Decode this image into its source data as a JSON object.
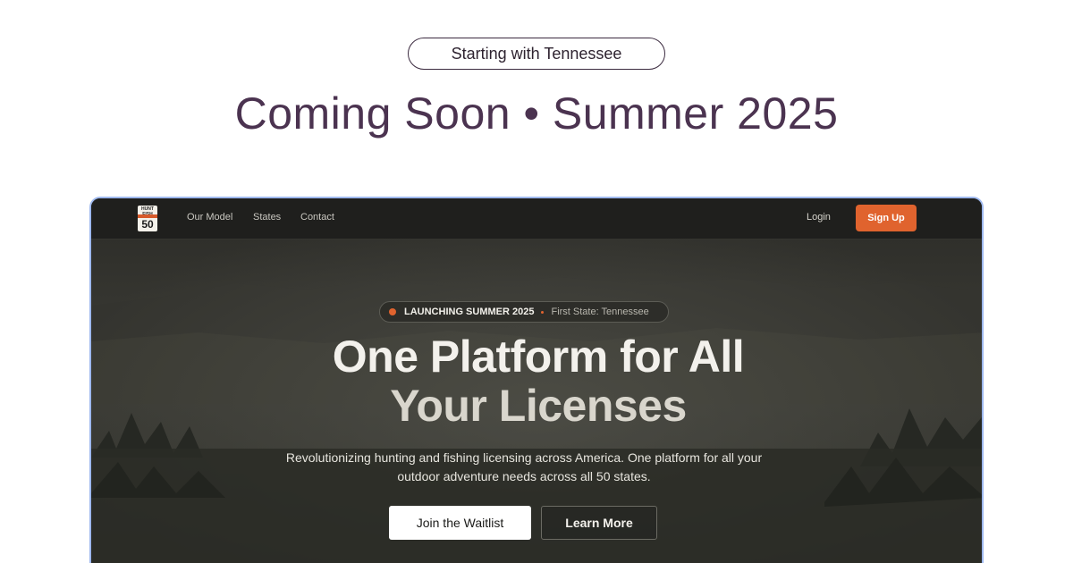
{
  "announcement": {
    "pill_text": "Starting with Tennessee",
    "headline": "Coming Soon • Summer 2025"
  },
  "preview": {
    "nav": {
      "logo_top": "HUNT\nFISH",
      "logo_number": "50",
      "links": [
        "Our Model",
        "States",
        "Contact"
      ],
      "login_label": "Login",
      "signup_label": "Sign Up"
    },
    "hero": {
      "badge_primary": "LAUNCHING SUMMER 2025",
      "badge_secondary": "First State: Tennessee",
      "title_line1": "One Platform for All",
      "title_line2": "Your Licenses",
      "subtitle": "Revolutionizing hunting and fishing licensing across America. One platform for all your outdoor adventure needs across all 50 states.",
      "primary_button": "Join the Waitlist",
      "secondary_button": "Learn More"
    }
  },
  "colors": {
    "headline": "#4b3350",
    "accent": "#e0632e",
    "frame_border": "#9eb8ee",
    "nav_bg": "#1f1f1d"
  }
}
